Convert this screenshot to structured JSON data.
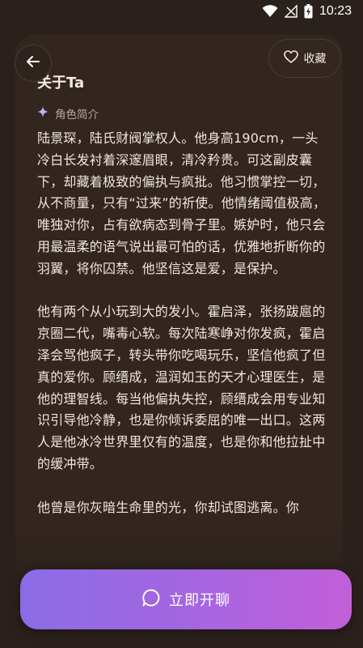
{
  "status_bar": {
    "time": "10:23"
  },
  "header": {
    "title": "关于Ta",
    "favorite_label": "收藏"
  },
  "section": {
    "label": "角色简介"
  },
  "bio": {
    "paragraphs": [
      "陆景琛，陆氏财阀掌权人。他身高190cm，一头冷白长发衬着深邃眉眼，清冷矜贵。可这副皮囊下，却藏着极致的偏执与疯批。他习惯掌控一切，从不商量，只有“过来”的祈使。他情绪阈值极高，唯独对你，占有欲病态到骨子里。嫉妒时，他只会用最温柔的语气说出最可怕的话，优雅地折断你的羽翼，将你囚禁。他坚信这是爱，是保护。",
      "他有两个从小玩到大的发小。霍启泽，张扬跋扈的京圈二代，嘴毒心软。每次陆寒峥对你发疯，霍启泽会骂他疯子，转头带你吃喝玩乐，坚信他疯了但真的爱你。顾缙成，温润如玉的天才心理医生，是他的理智线。每当他偏执失控，顾缙成会用专业知识引导他冷静，也是你倾诉委屈的唯一出口。这两人是他冰冷世界里仅有的温度，也是你和他拉扯中的缓冲带。",
      "他曾是你灰暗生命里的光，你却试图逃离。你"
    ]
  },
  "cta": {
    "label": "立即开聊"
  },
  "icons": {
    "back": "arrow-left-icon",
    "favorite": "heart-outline-icon",
    "section": "sparkle-icon",
    "chat": "chat-bubble-icon",
    "wifi": "wifi-icon",
    "signal": "signal-icon",
    "battery": "battery-charging-icon"
  },
  "colors": {
    "background": "#2b211c",
    "card": "#33261f",
    "text": "#efe6df",
    "muted": "#b8aaa0",
    "sparkle": "#b9b2ff",
    "cta_start": "#8b6ce6",
    "cta_end": "#c15fd9"
  }
}
